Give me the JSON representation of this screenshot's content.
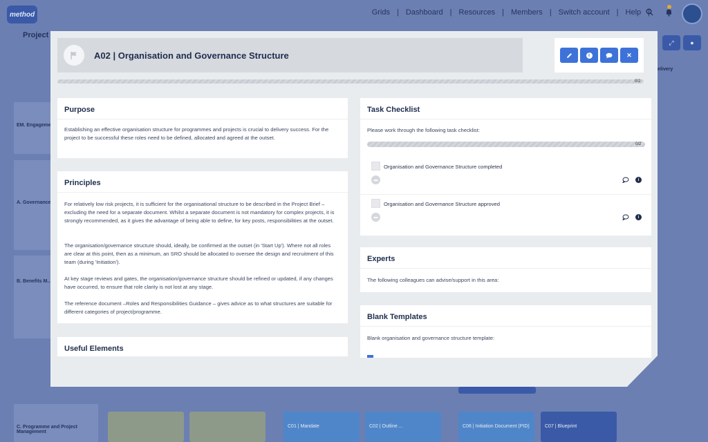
{
  "background": {
    "logo_text": "method",
    "nav": [
      "Grids",
      "Dashboard",
      "Resources",
      "Members",
      "Switch account",
      "Help"
    ],
    "project_label": "Project",
    "left_col": [
      "EM. Engagement Management",
      "A. Governance",
      "B. Benefits M...",
      "C. Programme and Project Management"
    ],
    "delivery_label": "Delivery",
    "tiles": [
      "",
      "",
      "C01 | Mandate",
      "C02 | Outline ...",
      "C06 | Initiation Document (PID)",
      "C07 | Blueprint"
    ]
  },
  "modal": {
    "title": "A02 | Organisation and Governance Structure",
    "progress_label": "0/2",
    "actions": {
      "edit": "✎",
      "info": "i",
      "comment": "●",
      "close": "✕"
    },
    "purpose": {
      "heading": "Purpose",
      "text": "Establishing an effective organisation structure for programmes and projects is crucial to delivery success. For the project to be successful these roles need to be defined, allocated and agreed at the outset."
    },
    "principles": {
      "heading": "Principles",
      "p1": "For relatively low risk projects, it is sufficient for the organisational structure to be described in the Project Brief – excluding the need for a separate document. Whilst a separate document is not mandatory for complex projects, it is strongly recommended, as it gives the advantage of being able to define, for key posts, responsibilities at the outset.",
      "p2": "The organisation/governance structure should, ideally, be confirmed at the outset (in 'Start Up'). Where not all roles are clear at this point, then as a minimum, an SRO should be allocated to oversee the design and recruitment of this team (during 'Initiation').",
      "p3": "At key stage reviews and gates, the organisation/governance structure should be refined or updated, if any changes have occurred, to ensure that role clarity is not lost at any stage.",
      "p4": "The reference document –Roles and Responsibilities Guidance – gives advice as to what structures are suitable for different categories of project/programme."
    },
    "useful_elements": {
      "heading": "Useful Elements"
    },
    "task_checklist": {
      "heading": "Task Checklist",
      "intro": "Please work through the following task checklist:",
      "progress_label": "0/2",
      "items": [
        {
          "label": "Organisation and Governance Structure completed"
        },
        {
          "label": "Organisation and Governance Structure approved"
        }
      ]
    },
    "experts": {
      "heading": "Experts",
      "text": "The following colleagues can advise/support in this area:"
    },
    "blank_templates": {
      "heading": "Blank Templates",
      "text": "Blank organisation and governance structure template:"
    }
  },
  "colors": {
    "accent": "#3d72d9",
    "overlay": "#6b7fb3",
    "heading": "#1f2d4d"
  }
}
